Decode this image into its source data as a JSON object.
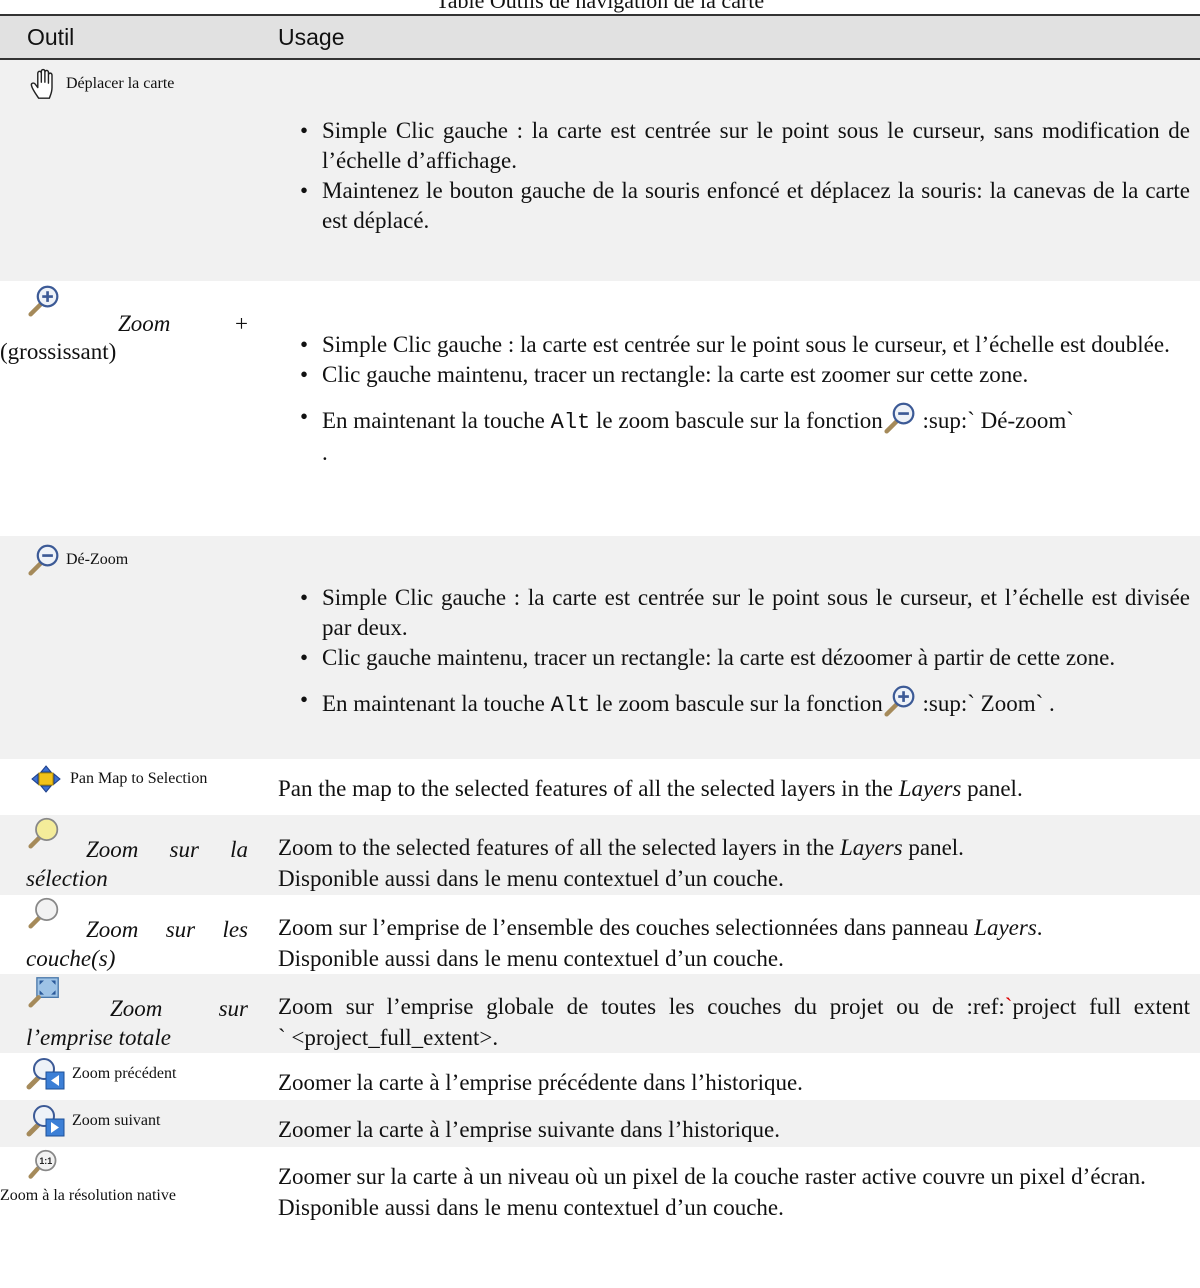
{
  "caption": "Table Outils de navigation de la carte",
  "headers": {
    "tool": "Outil",
    "usage": "Usage"
  },
  "rows": {
    "pan": {
      "tool_label": "Déplacer la carte",
      "icon": "hand-pan-icon",
      "bullets": [
        "Simple Clic gauche : la carte est centrée sur le point sous le curseur, sans modification de l’échelle d’affichage.",
        "Maintenez le bouton gauche de la souris enfoncé et déplacez la souris: la canevas de la carte est déplacé."
      ]
    },
    "zoom_in": {
      "tool_label_word": "Zoom",
      "tool_label_plus": "+",
      "tool_label_rest": "(grossissant)",
      "icon": "zoom-in-icon",
      "bullets": [
        "Simple Clic gauche : la carte est centrée sur le point sous le curseur, et l’échelle est doublée.",
        "Clic gauche maintenu, tracer un rectangle: la carte est zoomer sur cette zone."
      ],
      "alt_prefix": "En maintenant la touche",
      "alt_key": "Alt",
      "alt_middle": "le zoom bascule sur la fonction",
      "alt_suffix": ":sup:` Dé-zoom`",
      "alt_end": "."
    },
    "zoom_out": {
      "tool_label": "Dé-Zoom",
      "icon": "zoom-out-icon",
      "bullets": [
        "Simple Clic gauche : la carte est centrée sur le point sous le curseur, et l’échelle est divisée par deux.",
        "Clic gauche maintenu, tracer un rectangle: la carte est dézoomer à partir de cette zone."
      ],
      "alt_prefix": "En maintenant la touche",
      "alt_key": "Alt",
      "alt_middle": "le zoom bascule sur la fonction",
      "alt_suffix": ":sup:` Zoom` ."
    },
    "pan_sel": {
      "tool_label": "Pan Map to Selection",
      "icon": "pan-to-selection-icon",
      "usage_prefix": "Pan the map to the selected features of all the selected layers in the",
      "usage_italic": "Layers",
      "usage_suffix": "panel."
    },
    "zoom_sel": {
      "tool_label_line1": "Zoom sur la",
      "tool_label_line2": "sélection",
      "icon": "zoom-selection-icon",
      "usage_prefix": "Zoom to the selected features of all the selected layers in the",
      "usage_italic": "Layers",
      "usage_suffix": "panel.",
      "usage_line2": "Disponible aussi dans le menu contextuel d’un couche."
    },
    "zoom_layer": {
      "tool_label_line1": "Zoom sur les",
      "tool_label_line2": "couche(s)",
      "icon": "zoom-layer-icon",
      "usage_prefix": "Zoom sur l’emprise de l’ensemble des couches selectionnées dans panneau",
      "usage_italic": "Layers",
      "usage_suffix": ".",
      "usage_line2": "Disponible aussi dans le menu contextuel d’un couche."
    },
    "zoom_full": {
      "tool_label_line1": "Zoom sur",
      "tool_label_line2": "l’emprise totale",
      "icon": "zoom-full-extent-icon",
      "usage_line1_a": "Zoom sur l’emprise globale de toutes les couches du projet ou de :ref:",
      "usage_line1_tick": "`",
      "usage_line1_b": "project full extent",
      "usage_line2": "` <project_full_extent>."
    },
    "zoom_prev": {
      "tool_label": "Zoom précédent",
      "icon": "zoom-last-icon",
      "usage": "Zoomer la carte à l’emprise précédente dans l’historique."
    },
    "zoom_next": {
      "tool_label": "Zoom suivant",
      "icon": "zoom-next-icon",
      "usage": "Zoomer la carte à l’emprise suivante dans l’historique."
    },
    "zoom_native": {
      "tool_label": "Zoom à la résolution native",
      "icon": "zoom-actual-size-icon",
      "icon_text": "1:1",
      "usage_line1": "Zoomer sur la carte à un niveau où un pixel de la couche raster active couvre un pixel d’écran.",
      "usage_line2": "Disponible aussi dans le menu contextuel d’un couche."
    }
  }
}
